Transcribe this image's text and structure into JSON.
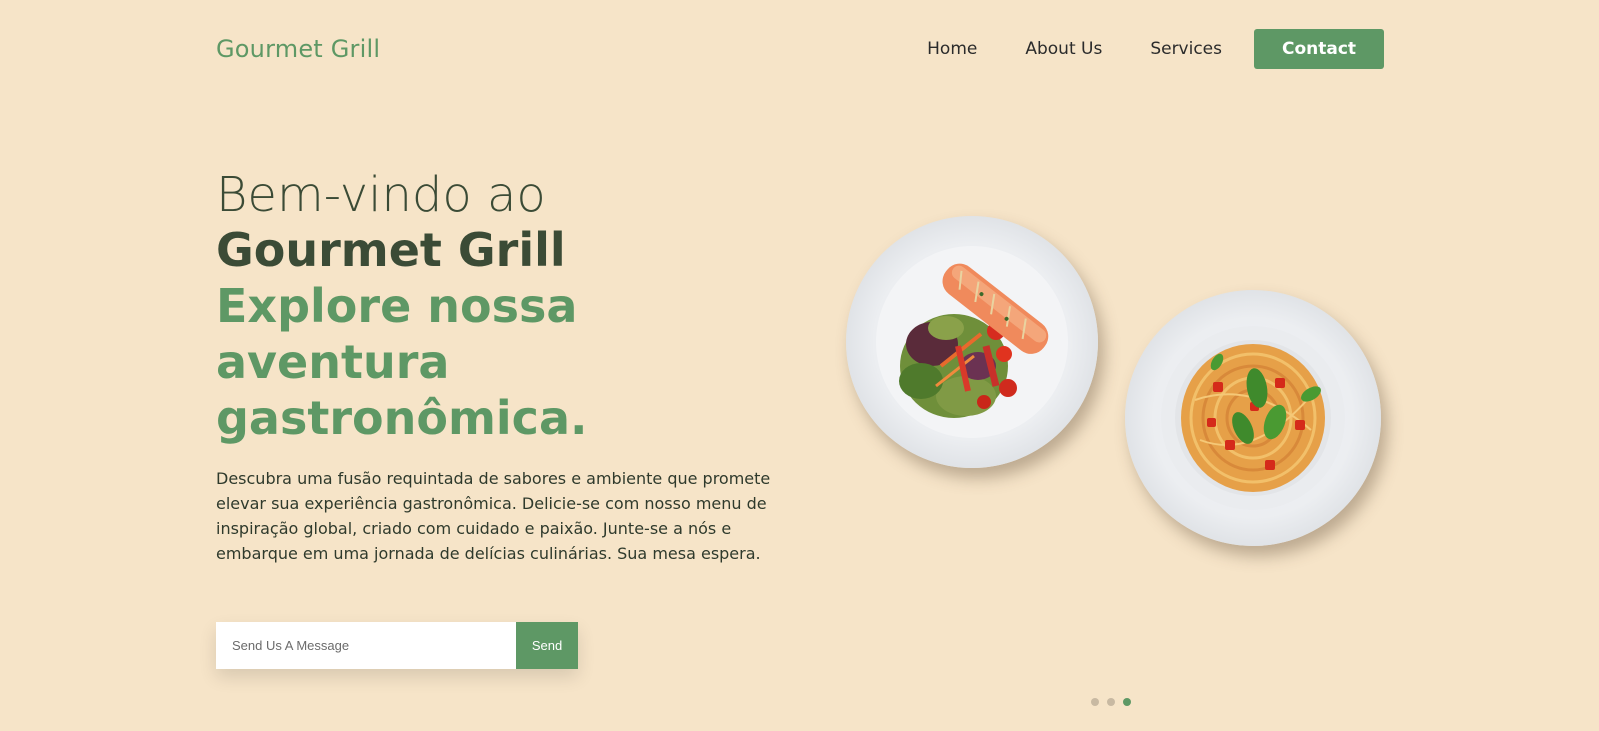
{
  "nav": {
    "logo": "Gourmet Grill",
    "links": [
      "Home",
      "About Us",
      "Services"
    ],
    "contact_label": "Contact"
  },
  "hero": {
    "line1": "Bem-vindo ao",
    "line2": "Gourmet Grill",
    "line3": "Explore nossa aventura gastronômica.",
    "description": "Descubra uma fusão requintada de sabores e ambiente que promete elevar sua experiência gastronômica. Delicie-se com nosso menu de inspiração global, criado com cuidado e paixão. Junte-se a nós e embarque em uma jornada de delícias culinárias. Sua mesa espera."
  },
  "form": {
    "placeholder": "Send Us A Message",
    "send_label": "Send"
  },
  "carousel": {
    "total": 3,
    "active_index": 2
  },
  "colors": {
    "background": "#f6e4c8",
    "accent": "#5e9865",
    "heading_dark": "#3b4b36"
  },
  "images": [
    "salmon-salad-plate",
    "spaghetti-tomato-basil-plate"
  ]
}
